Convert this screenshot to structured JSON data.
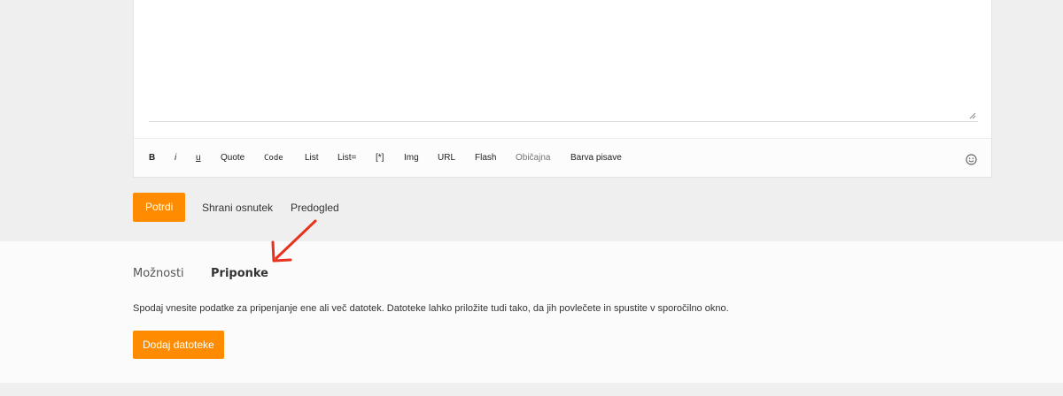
{
  "toolbar": {
    "items": [
      "B",
      "i",
      "u",
      "Quote",
      "Code",
      "List",
      "List=",
      "[*]",
      "Img",
      "URL",
      "Flash",
      "Običajna",
      "Barva pisave"
    ]
  },
  "actions": {
    "submit": "Potrdi",
    "save_draft": "Shrani osnutek",
    "preview": "Predogled"
  },
  "tabs": {
    "options": "Možnosti",
    "attachments": "Priponke"
  },
  "attachments": {
    "description": "Spodaj vnesite podatke za pripenjanje ene ali več datotek. Datoteke lahko priložite tudi tako, da jih povlečete in spustite v sporočilno okno.",
    "add_button": "Dodaj datoteke"
  },
  "colors": {
    "accent": "#ff8c00",
    "annotation_arrow": "#e8321e"
  },
  "icons": {
    "smiley": "smiley-icon",
    "resize": "resize-handle-icon",
    "arrow": "annotation-arrow-icon"
  }
}
